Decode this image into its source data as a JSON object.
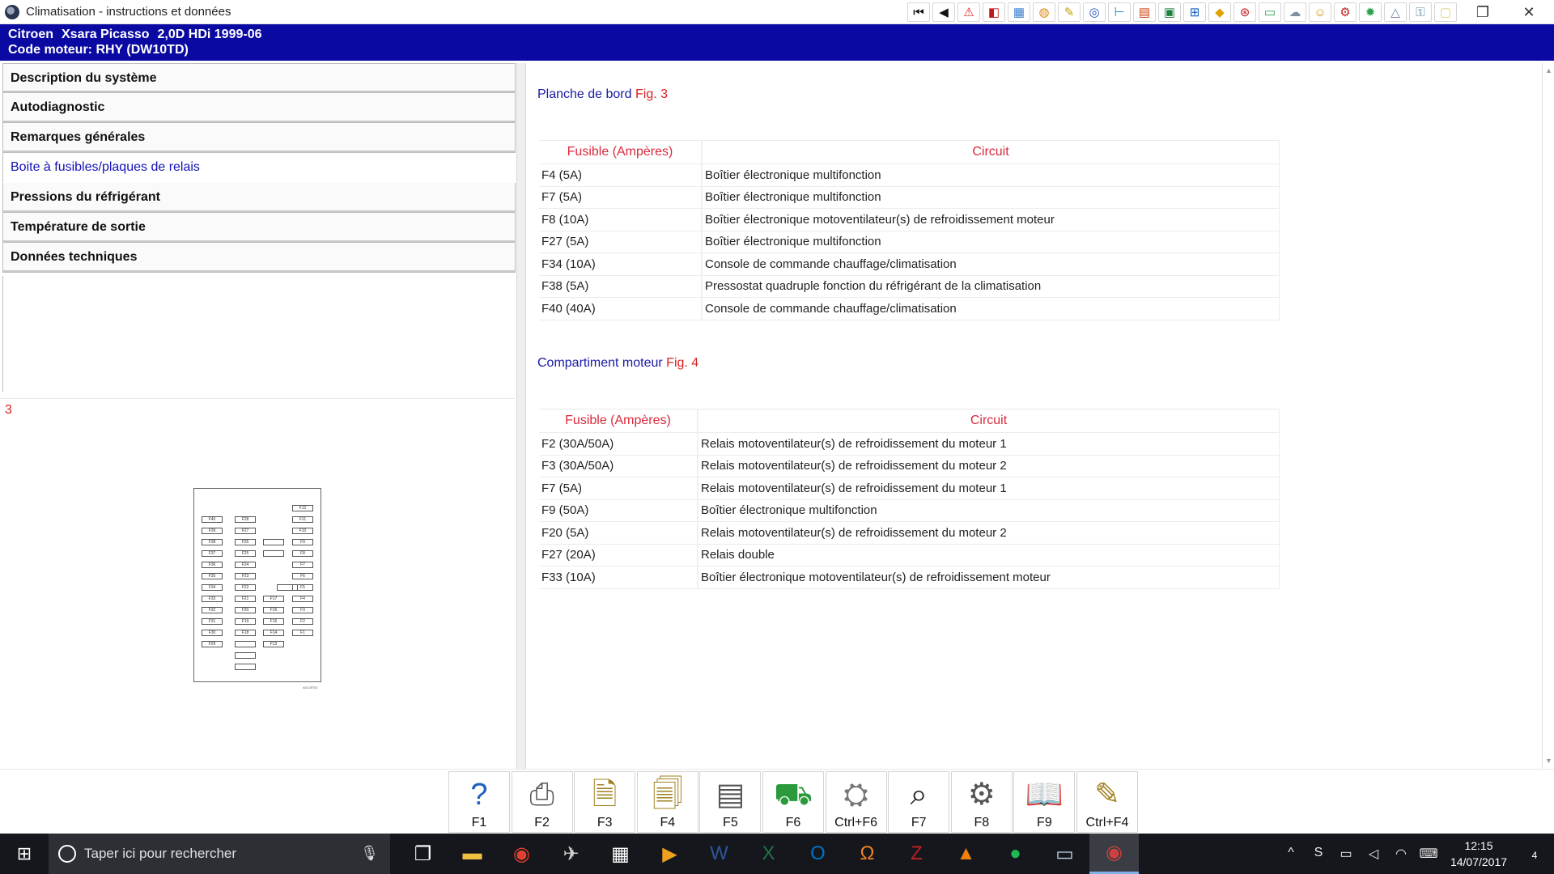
{
  "window": {
    "title": "Climatisation - instructions et données",
    "controls": {
      "restore": "❐",
      "close": "✕"
    }
  },
  "toolbar_icons": [
    {
      "name": "first-icon",
      "glyph": "⏮",
      "color": "#111"
    },
    {
      "name": "prev-icon",
      "glyph": "◀",
      "color": "#111"
    },
    {
      "name": "warning-icon",
      "glyph": "⚠",
      "color": "#e02020"
    },
    {
      "name": "flag-icon",
      "glyph": "◧",
      "color": "#c01818"
    },
    {
      "name": "map-icon",
      "glyph": "▦",
      "color": "#3a7fd0"
    },
    {
      "name": "globe-icon",
      "glyph": "◍",
      "color": "#e08a10"
    },
    {
      "name": "tools-icon",
      "glyph": "✎",
      "color": "#c0a000"
    },
    {
      "name": "disc-icon",
      "glyph": "◎",
      "color": "#2050c0"
    },
    {
      "name": "pipe-icon",
      "glyph": "⊢",
      "color": "#2090c0"
    },
    {
      "name": "chart-icon",
      "glyph": "▤",
      "color": "#d04010"
    },
    {
      "name": "book-icon",
      "glyph": "▣",
      "color": "#208040"
    },
    {
      "name": "network-icon",
      "glyph": "⊞",
      "color": "#1060c0"
    },
    {
      "name": "tag-icon",
      "glyph": "◆",
      "color": "#e0a000"
    },
    {
      "name": "car-icon",
      "glyph": "⊛",
      "color": "#c02020"
    },
    {
      "name": "battery-icon",
      "glyph": "▭",
      "color": "#20a040"
    },
    {
      "name": "cloud-icon",
      "glyph": "☁",
      "color": "#8090a0"
    },
    {
      "name": "smiley-icon",
      "glyph": "☺",
      "color": "#d0a000"
    },
    {
      "name": "engine-icon",
      "glyph": "⚙",
      "color": "#c02020"
    },
    {
      "name": "gear-icon",
      "glyph": "✹",
      "color": "#30a050"
    },
    {
      "name": "alert-outline-icon",
      "glyph": "△",
      "color": "#7080a0"
    },
    {
      "name": "key-icon",
      "glyph": "⚿",
      "color": "#5080a0"
    },
    {
      "name": "note-icon",
      "glyph": "▢",
      "color": "#e0d080"
    }
  ],
  "vehicle": {
    "make": "Citroen",
    "model": "Xsara Picasso",
    "engine": "2,0D HDi 1999-06",
    "code_line": "Code moteur: RHY (DW10TD)"
  },
  "nav": [
    {
      "label": "Description du système",
      "active": false,
      "name": "nav-item-description"
    },
    {
      "label": "Autodiagnostic",
      "active": false,
      "name": "nav-item-autodiagnostic"
    },
    {
      "label": "Remarques générales",
      "active": false,
      "name": "nav-item-remarques"
    },
    {
      "label": "Boite à fusibles/plaques de relais",
      "active": true,
      "name": "nav-item-fusibles"
    },
    {
      "label": "Pressions du réfrigérant",
      "active": false,
      "name": "nav-item-pressions"
    },
    {
      "label": "Température de sortie",
      "active": false,
      "name": "nav-item-temperature"
    },
    {
      "label": "Données techniques",
      "active": false,
      "name": "nav-item-donnees"
    }
  ],
  "figure": {
    "number": "3",
    "fuse_labels_col1": [
      "F40",
      "F39",
      "F38",
      "F37",
      "F36",
      "F35",
      "F34",
      "F33",
      "F32",
      "F31",
      "F30",
      "F29"
    ],
    "fuse_labels_col2": [
      "F28",
      "F27",
      "F26",
      "F25",
      "F24",
      "F23",
      "F22",
      "F21",
      "F20",
      "F19",
      "F18"
    ],
    "fuse_labels_col3": [
      "F17",
      "F16",
      "F15",
      "F14",
      "F13"
    ],
    "fuse_labels_col4": [
      "F12",
      "F11",
      "F10",
      "F9",
      "F8",
      "F7",
      "F6",
      "F5",
      "F4",
      "F3",
      "F2",
      "F1"
    ],
    "code": "A02-BT53"
  },
  "section1": {
    "title": "Planche de bord",
    "fig": "Fig. 3",
    "headers": [
      "Fusible (Ampères)",
      "Circuit"
    ],
    "rows": [
      [
        "F4 (5A)",
        "Boîtier électronique multifonction"
      ],
      [
        "F7 (5A)",
        "Boîtier électronique multifonction"
      ],
      [
        "F8 (10A)",
        "Boîtier électronique motoventilateur(s) de refroidissement moteur"
      ],
      [
        "F27 (5A)",
        "Boîtier électronique multifonction"
      ],
      [
        "F34 (10A)",
        "Console de commande chauffage/climatisation"
      ],
      [
        "F38 (5A)",
        "Pressostat quadruple fonction du réfrigérant de la climatisation"
      ],
      [
        "F40 (40A)",
        "Console de commande chauffage/climatisation"
      ]
    ]
  },
  "section2": {
    "title": "Compartiment moteur",
    "fig": "Fig. 4",
    "headers": [
      "Fusible (Ampères)",
      "Circuit"
    ],
    "rows": [
      [
        "F2 (30A/50A)",
        "Relais motoventilateur(s) de refroidissement du moteur 1"
      ],
      [
        "F3 (30A/50A)",
        "Relais motoventilateur(s) de refroidissement du moteur 2"
      ],
      [
        "F7 (5A)",
        "Relais motoventilateur(s) de refroidissement du moteur 1"
      ],
      [
        "F9 (50A)",
        "Boîtier électronique multifonction"
      ],
      [
        "F20 (5A)",
        "Relais motoventilateur(s) de refroidissement du moteur 2"
      ],
      [
        "F27 (20A)",
        "Relais double"
      ],
      [
        "F33 (10A)",
        "Boîtier électronique motoventilateur(s) de refroidissement moteur"
      ]
    ]
  },
  "fkeys": [
    {
      "label": "F1",
      "glyph": "?",
      "color": "#1f5fbf",
      "name": "f1-help-button",
      "icon": "help-icon"
    },
    {
      "label": "F2",
      "glyph": "⎙",
      "color": "#555",
      "name": "f2-print-button",
      "icon": "printer-icon"
    },
    {
      "label": "F3",
      "glyph": "🗎",
      "color": "#a08020",
      "name": "f3-button",
      "icon": "document-icon"
    },
    {
      "label": "F4",
      "glyph": "🗐",
      "color": "#a08020",
      "name": "f4-button",
      "icon": "documents-icon"
    },
    {
      "label": "F5",
      "glyph": "▤",
      "color": "#555",
      "name": "f5-button",
      "icon": "page-icon"
    },
    {
      "label": "F6",
      "glyph": "⛟",
      "color": "#2a9a3a",
      "name": "f6-button",
      "icon": "vehicle-icon"
    },
    {
      "label": "Ctrl+F6",
      "glyph": "⛭",
      "color": "#777",
      "name": "ctrl-f6-button",
      "icon": "settings-icon"
    },
    {
      "label": "F7",
      "glyph": "⌕",
      "color": "#222",
      "name": "f7-button",
      "icon": "magnifier-icon"
    },
    {
      "label": "F8",
      "glyph": "⚙",
      "color": "#555",
      "name": "f8-button",
      "icon": "mechanic-icon"
    },
    {
      "label": "F9",
      "glyph": "📖",
      "color": "#444",
      "name": "f9-button",
      "icon": "manual-icon"
    },
    {
      "label": "Ctrl+F4",
      "glyph": "✎",
      "color": "#a08020",
      "name": "ctrl-f4-button",
      "icon": "notes-icon"
    }
  ],
  "taskbar": {
    "search_placeholder": "Taper ici pour rechercher",
    "apps": [
      {
        "name": "task-view-icon",
        "glyph": "❐",
        "color": "#ffffff",
        "active": false
      },
      {
        "name": "file-explorer-icon",
        "glyph": "▬",
        "color": "#f0c040",
        "active": false
      },
      {
        "name": "chrome-icon",
        "glyph": "◉",
        "color": "#e04030",
        "active": false
      },
      {
        "name": "tool-app-icon",
        "glyph": "✈",
        "color": "#d0d0d0",
        "active": false
      },
      {
        "name": "calculator-icon",
        "glyph": "▦",
        "color": "#ffffff",
        "active": false
      },
      {
        "name": "media-player-icon",
        "glyph": "▶",
        "color": "#f0a020",
        "active": false
      },
      {
        "name": "word-icon",
        "glyph": "W",
        "color": "#2b579a",
        "active": false
      },
      {
        "name": "excel-icon",
        "glyph": "X",
        "color": "#217346",
        "active": false
      },
      {
        "name": "outlook-icon",
        "glyph": "O",
        "color": "#0072c6",
        "active": false
      },
      {
        "name": "headphones-icon",
        "glyph": "Ω",
        "color": "#f08020",
        "active": false
      },
      {
        "name": "filezilla-icon",
        "glyph": "Z",
        "color": "#c02020",
        "active": false
      },
      {
        "name": "vlc-icon",
        "glyph": "▲",
        "color": "#f08010",
        "active": false
      },
      {
        "name": "spotify-icon",
        "glyph": "●",
        "color": "#1db954",
        "active": false
      },
      {
        "name": "laptop-icon",
        "glyph": "▭",
        "color": "#c0d0e0",
        "active": false
      },
      {
        "name": "autodata-icon",
        "glyph": "◉",
        "color": "#d04040",
        "active": true
      }
    ],
    "tray": [
      {
        "name": "chevron-up-icon",
        "glyph": "^"
      },
      {
        "name": "skype-icon",
        "glyph": "S"
      },
      {
        "name": "battery-icon",
        "glyph": "▭"
      },
      {
        "name": "volume-icon",
        "glyph": "◁"
      },
      {
        "name": "wifi-icon",
        "glyph": "◠"
      },
      {
        "name": "keyboard-icon",
        "glyph": "⌨"
      }
    ],
    "time": "12:15",
    "date": "14/07/2017",
    "notification_count": "4"
  }
}
